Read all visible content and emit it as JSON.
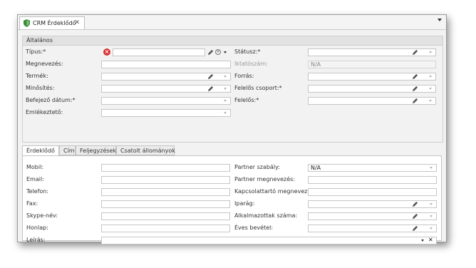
{
  "window": {
    "tab_title": "CRM Érdeklődő",
    "tab_close": "✕"
  },
  "general": {
    "header": "Általános",
    "tipus_label": "Típus:*",
    "megnevezes_label": "Megnevezés:",
    "termek_label": "Termék:",
    "minosites_label": "Minősítés:",
    "befejezo_datum_label": "Befejező dátum:*",
    "emlekezteto_label": "Emlékeztető:",
    "statusz_label": "Státusz:*",
    "iktatoszam_label": "Iktatószám:",
    "iktatoszam_value": "N/A",
    "forras_label": "Forrás:",
    "felelos_csoport_label": "Felelős csoport:*",
    "felelos_label": "Felelős:*",
    "error_glyph": "×",
    "clear_glyph": "×"
  },
  "tabs": [
    {
      "label": "Érdeklődő",
      "active": true
    },
    {
      "label": "Cím",
      "active": false
    },
    {
      "label": "Feljegyzések",
      "active": false
    },
    {
      "label": "Csatolt állományok",
      "active": false
    }
  ],
  "contact": {
    "mobil_label": "Mobil:",
    "email_label": "Email:",
    "telefon_label": "Telefon:",
    "fax_label": "Fax:",
    "skype_label": "Skype-név:",
    "honlap_label": "Honlap:",
    "leiras_label": "Leírás:",
    "partner_szabaly_label": "Partner szabály:",
    "partner_szabaly_value": "N/A",
    "partner_megnevezes_label": "Partner megnevezés:",
    "kapcsolattarto_label": "Kapcsolattartó megnevezés:",
    "iparag_label": "Iparág:",
    "alkalmazottak_label": "Alkalmazottak száma:",
    "eves_bevetel_label": "Éves bevétel:",
    "leiras_clear": "✕"
  },
  "icons": {
    "pencil": "pencil-icon",
    "dropdown": "chevron-down-icon",
    "error": "error-icon",
    "clear": "clear-icon",
    "shield": "shield-icon"
  },
  "colors": {
    "error": "#d93030",
    "shield": "#3a8a3a"
  }
}
